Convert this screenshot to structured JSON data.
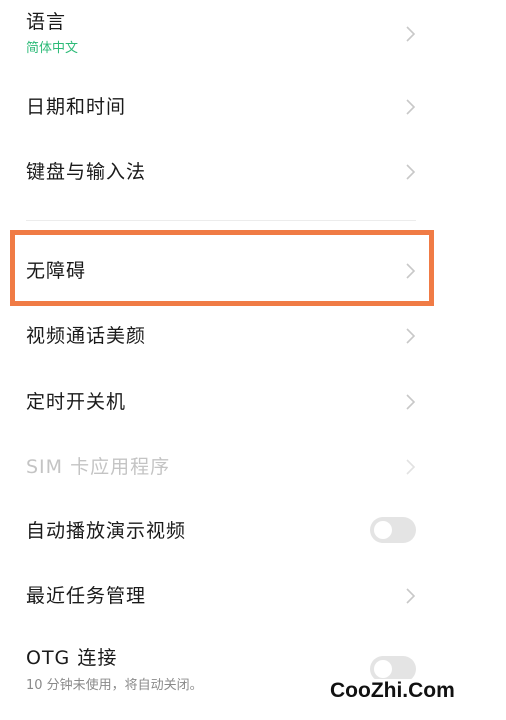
{
  "settings": {
    "language": {
      "label": "语言",
      "value": "简体中文"
    },
    "datetime": {
      "label": "日期和时间"
    },
    "keyboard": {
      "label": "键盘与输入法"
    },
    "accessibility": {
      "label": "无障碍"
    },
    "video_beauty": {
      "label": "视频通话美颜"
    },
    "scheduled_power": {
      "label": "定时开关机"
    },
    "sim_toolkit": {
      "label": "SIM 卡应用程序",
      "enabled": false
    },
    "autoplay_demo": {
      "label": "自动播放演示视频",
      "on": false
    },
    "recent_tasks": {
      "label": "最近任务管理"
    },
    "otg": {
      "label": "OTG 连接",
      "description": "10 分钟未使用，将自动关闭。",
      "on": false
    }
  },
  "watermark": "CooZhi.Com",
  "colors": {
    "accent_green": "#2dbb78",
    "highlight_orange": "#f07b45"
  },
  "icons": {
    "row_chevron": "chevron-right-icon"
  }
}
